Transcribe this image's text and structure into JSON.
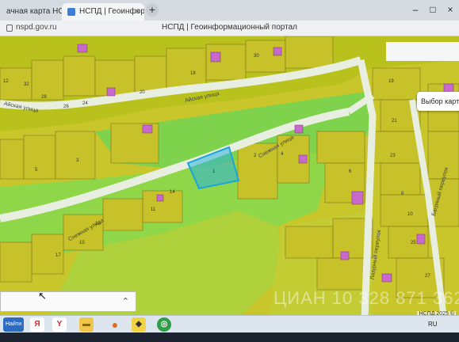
{
  "browser": {
    "tabs": [
      {
        "label": "ачная карта НСВД"
      },
      {
        "label": "НСПД | Геоинформа"
      }
    ],
    "tab_close": "×",
    "new_tab": "+",
    "window_controls": {
      "minimize": "–",
      "maximize": "□",
      "close": "×"
    },
    "url": "nspd.gov.ru",
    "page_title": "НСПД | Геоинформационный портал"
  },
  "map": {
    "streets": [
      "Айская улица",
      "Айская улица",
      "Снежная улица",
      "Снежная улица",
      "Багряный переулок",
      "Лазурный переулок"
    ],
    "parcel_labels": [
      "12",
      "28",
      "26",
      "24",
      "18",
      "20",
      "30",
      "32",
      "3",
      "5",
      "1",
      "2",
      "4",
      "6",
      "8",
      "10",
      "14",
      "11",
      "13",
      "15",
      "17",
      "19",
      "21",
      "23",
      "25",
      "27"
    ],
    "layer_button": "Выбор карты",
    "copyright": "НСПД 2025 ©",
    "watermark": "ЦИАН 10 328 871 362",
    "search_chevron": "⌃"
  },
  "taskbar": {
    "search_label": "Найти",
    "lang": "RU"
  },
  "colors": {
    "parcel_fill": "#c6c72c",
    "road": "#e6ecdc",
    "grass": "#6bd04a",
    "selected": "#2bb3e0"
  }
}
